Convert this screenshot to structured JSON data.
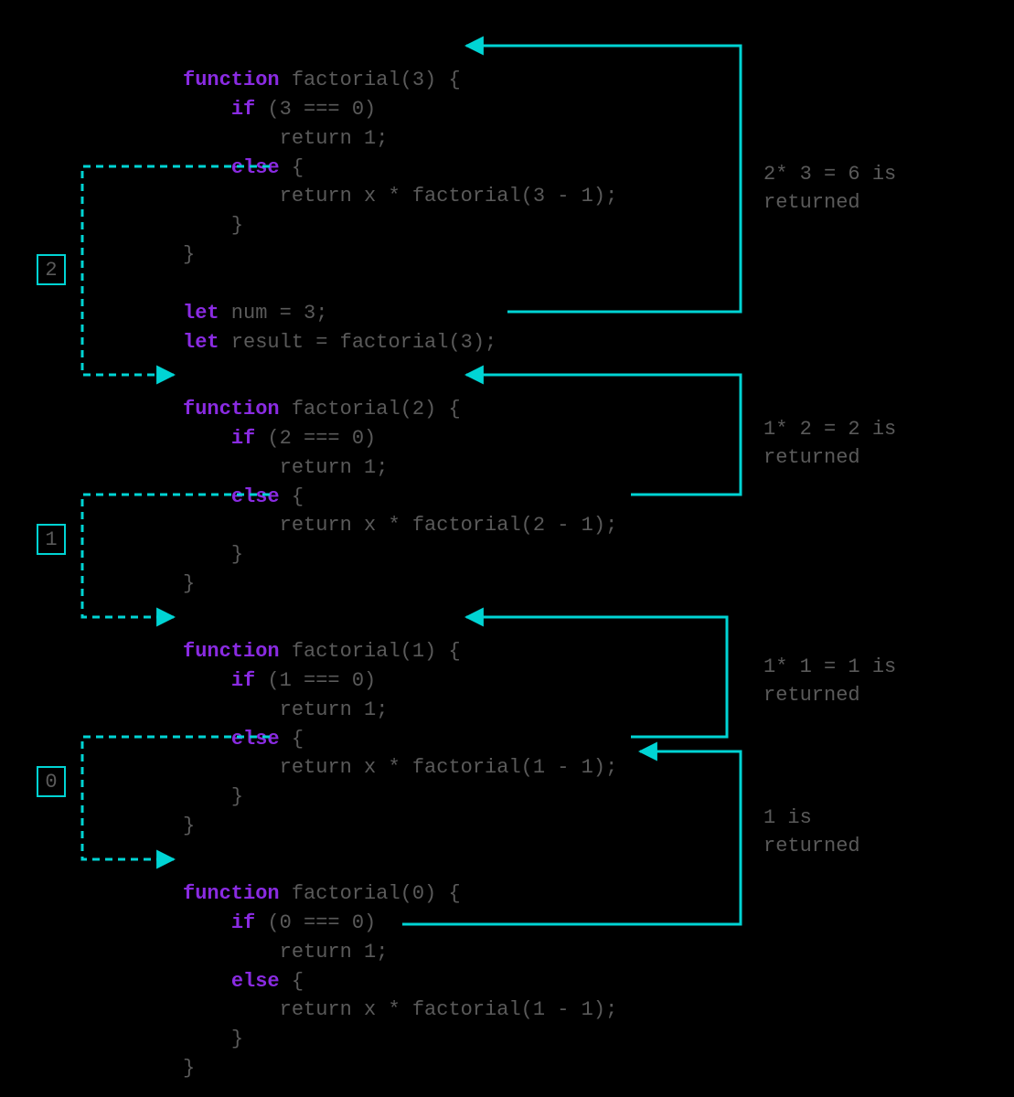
{
  "colors": {
    "keyword": "#8a2be2",
    "dim": "#5a5a5a",
    "accent": "#00d4d4",
    "bg": "#000"
  },
  "steps": [
    {
      "label": "2"
    },
    {
      "label": "1"
    },
    {
      "label": "0"
    }
  ],
  "annotations": [
    {
      "text": "2* 3 = 6 is\nreturned"
    },
    {
      "text": "1* 2 = 2 is\nreturned"
    },
    {
      "text": "1* 1 = 1 is\nreturned"
    },
    {
      "text": "1 is\nreturned"
    }
  ],
  "blocks": {
    "b1": {
      "fn_kw": "function",
      "fn_sig": " factorial(3) {",
      "if_kw": "if",
      "if_cond": " (3 === 0)",
      "ret1": "return 1;",
      "else_kw": "else",
      "else_open": " {",
      "ret2": "return x * factorial(3 - 1);",
      "close1": "}",
      "close2": "}",
      "let1_kw": "let",
      "let1_rest": " num = 3;",
      "let2_kw": "let",
      "let2_rest": " result = factorial(3);"
    },
    "b2": {
      "fn_kw": "function",
      "fn_sig": " factorial(2) {",
      "if_kw": "if",
      "if_cond": " (2 === 0)",
      "ret1": "return 1;",
      "else_kw": "else",
      "else_open": " {",
      "ret2": "return x * factorial(2 - 1);",
      "close1": "}",
      "close2": "}"
    },
    "b3": {
      "fn_kw": "function",
      "fn_sig": " factorial(1) {",
      "if_kw": "if",
      "if_cond": " (1 === 0)",
      "ret1": "return 1;",
      "else_kw": "else",
      "else_open": " {",
      "ret2": "return x * factorial(1 - 1);",
      "close1": "}",
      "close2": "}"
    },
    "b4": {
      "fn_kw": "function",
      "fn_sig": " factorial(0) {",
      "if_kw": "if",
      "if_cond": " (0 === 0)",
      "ret1": "return 1;",
      "else_kw": "else",
      "else_open": " {",
      "ret2": "return x * factorial(1 - 1);",
      "close1": "}",
      "close2": "}"
    }
  }
}
